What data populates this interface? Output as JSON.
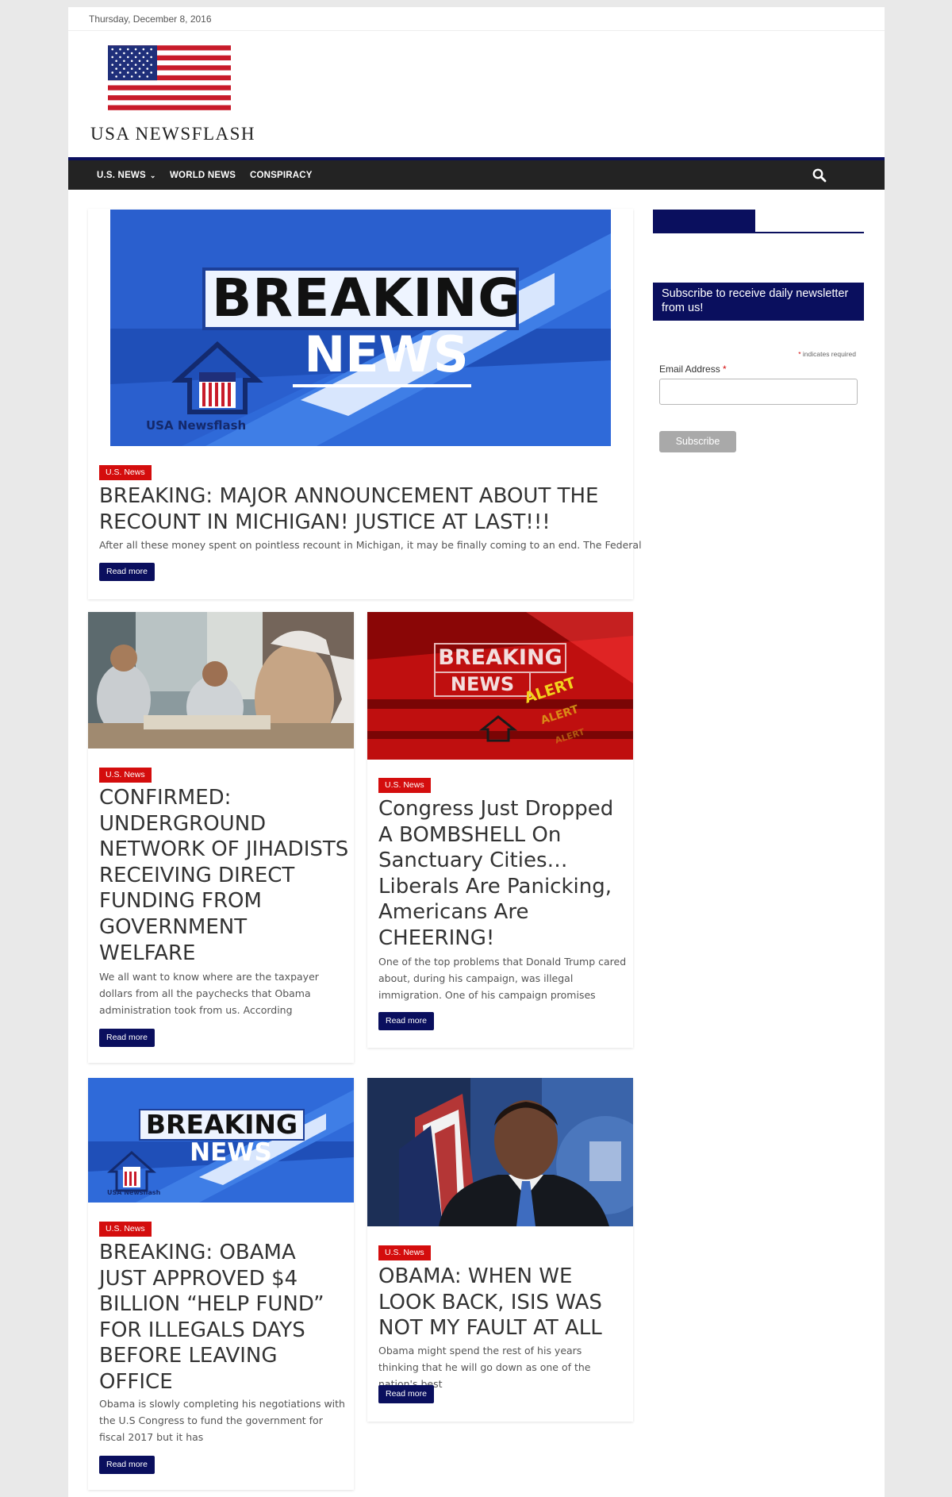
{
  "topbar": {
    "date": "Thursday, December 8, 2016"
  },
  "site": {
    "title": "USA NEWSFLASH",
    "logo_icon": "us-flag-icon"
  },
  "nav": {
    "items": [
      "U.S. NEWS",
      "WORLD NEWS",
      "CONSPIRACY"
    ],
    "dropdown_indicator": "⌄",
    "search_icon": "search-icon"
  },
  "featured": {
    "image_text": {
      "line1": "BREAKING",
      "line2": "NEWS",
      "brand": "USA Newsflash"
    },
    "category": "U.S. News",
    "title": "BREAKING: MAJOR ANNOUNCEMENT ABOUT THE RECOUNT IN MICHIGAN! JUSTICE AT LAST!!!",
    "excerpt": "After all these money spent on pointless recount in Michigan, it may be finally coming to an end. The Federal",
    "read_more": "Read more"
  },
  "posts": [
    {
      "category": "U.S. News",
      "title": "CONFIRMED: UNDERGROUND NETWORK OF JIHADISTS RECEIVING DIRECT FUNDING FROM GOVERNMENT WELFARE",
      "excerpt": "We all want to know where are the taxpayer dollars from all the paychecks that Obama administration took from us. According",
      "read_more": "Read more"
    },
    {
      "image_text": {
        "line1": "BREAKING",
        "line2": "NEWS",
        "alert": "ALERT"
      },
      "category": "U.S. News",
      "title": "Congress Just Dropped A BOMBSHELL On Sanctuary Cities… Liberals Are Panicking, Americans Are CHEERING!",
      "excerpt": "One of the top problems that Donald Trump cared about, during his campaign, was illegal immigration. One of his campaign promises",
      "read_more": "Read more"
    },
    {
      "image_text": {
        "line1": "BREAKING",
        "line2": "NEWS",
        "brand": "USA Newsflash"
      },
      "category": "U.S. News",
      "title": "BREAKING: OBAMA JUST APPROVED $4 BILLION “HELP FUND” FOR ILLEGALS DAYS BEFORE LEAVING OFFICE",
      "excerpt": "Obama is slowly completing his negotiations with the U.S Congress to fund the government for fiscal 2017 but it has",
      "read_more": "Read more"
    },
    {
      "category": "U.S. News",
      "title": "OBAMA: WHEN WE LOOK BACK, ISIS WAS NOT MY FAULT AT ALL",
      "excerpt": "Obama might spend the rest of his years thinking that he will go down as one of the nation's best",
      "read_more": "Read more"
    }
  ],
  "sidebar": {
    "newsletter_heading": "Subscribe to receive daily newsletter from us!",
    "required_star": "*",
    "required_note": "indicates required",
    "email_label": "Email Address",
    "email_value": "",
    "subscribe_label": "Subscribe"
  },
  "colors": {
    "navy": "#0a0f5e",
    "badge_red": "#d40d0d",
    "nav_bg": "#232323",
    "breaking_blue": "#2f6ad9"
  }
}
